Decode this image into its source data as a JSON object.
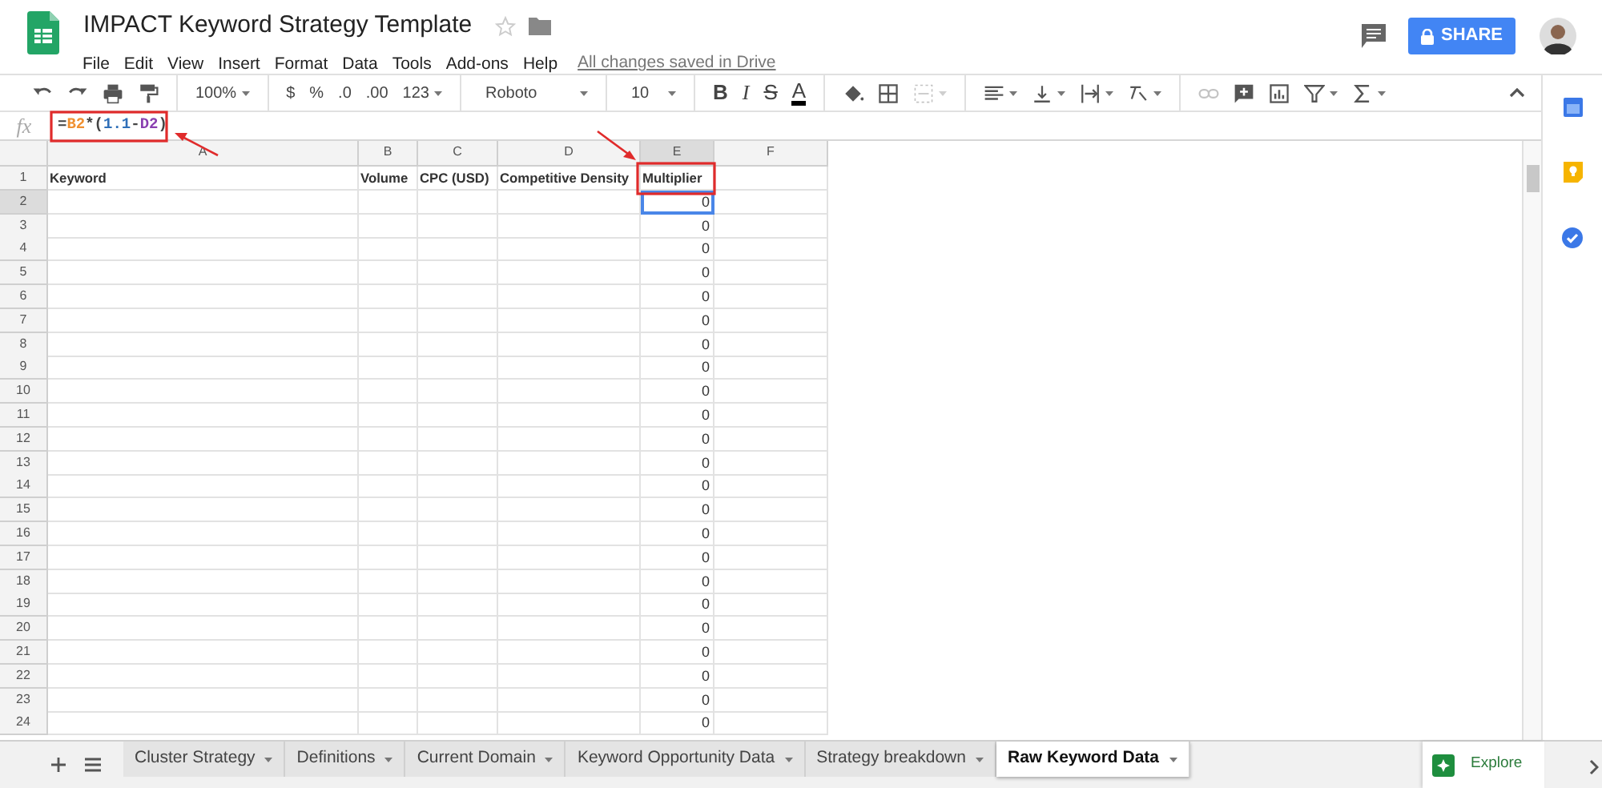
{
  "document": {
    "title": "IMPACT Keyword Strategy Template",
    "save_status": "All changes saved in Drive"
  },
  "menu": [
    "File",
    "Edit",
    "View",
    "Insert",
    "Format",
    "Data",
    "Tools",
    "Add-ons",
    "Help"
  ],
  "share_button": "SHARE",
  "toolbar": [
    {
      "kind": "undo",
      "disabled": false
    },
    {
      "kind": "redo",
      "disabled": false
    },
    {
      "kind": "print",
      "disabled": false
    },
    {
      "kind": "paint",
      "disabled": false
    },
    {
      "kind": "separator"
    },
    {
      "kind": "dropdown",
      "text": "100%",
      "disabled": false
    },
    {
      "kind": "separator"
    },
    {
      "kind": "text",
      "text": "$",
      "disabled": false
    },
    {
      "kind": "text",
      "text": "%",
      "disabled": false
    },
    {
      "kind": "text",
      "text": ".0",
      "disabled": false
    },
    {
      "kind": "text",
      "text": ".00",
      "disabled": false
    },
    {
      "kind": "dropdown",
      "text": "123",
      "disabled": false
    },
    {
      "kind": "separator"
    },
    {
      "kind": "font",
      "text": "Roboto",
      "disabled": false
    },
    {
      "kind": "separator"
    },
    {
      "kind": "font",
      "text": "10",
      "disabled": false
    },
    {
      "kind": "separator"
    },
    {
      "kind": "bold",
      "text": "B",
      "disabled": false
    },
    {
      "kind": "italic",
      "text": "I",
      "disabled": false
    },
    {
      "kind": "strike",
      "text": "S",
      "disabled": false
    },
    {
      "kind": "textcolor",
      "text": "A",
      "disabled": false
    },
    {
      "kind": "separator"
    },
    {
      "kind": "fill",
      "disabled": false
    },
    {
      "kind": "borders",
      "disabled": false
    },
    {
      "kind": "merge",
      "disabled": true
    },
    {
      "kind": "separator"
    },
    {
      "kind": "halign",
      "disabled": false
    },
    {
      "kind": "valign",
      "disabled": false
    },
    {
      "kind": "wrap",
      "disabled": false
    },
    {
      "kind": "rotate",
      "disabled": false
    },
    {
      "kind": "separator"
    },
    {
      "kind": "link",
      "disabled": true
    },
    {
      "kind": "comment",
      "disabled": false
    },
    {
      "kind": "chart",
      "disabled": false
    },
    {
      "kind": "filter",
      "disabled": false
    },
    {
      "kind": "functions",
      "disabled": false
    }
  ],
  "formula_label": "fx",
  "formula": [
    {
      "text": "=",
      "color": "#444444"
    },
    {
      "text": "B2",
      "color": "#f09030"
    },
    {
      "text": "*(",
      "color": "#444444"
    },
    {
      "text": "1.1",
      "color": "#2f6fb8"
    },
    {
      "text": "-",
      "color": "#444444"
    },
    {
      "text": "D2",
      "color": "#8a3fb0"
    },
    {
      "text": ")",
      "color": "#444444"
    }
  ],
  "columns": [
    {
      "label": "A",
      "selected": false
    },
    {
      "label": "B",
      "selected": false
    },
    {
      "label": "C",
      "selected": false
    },
    {
      "label": "D",
      "selected": false
    },
    {
      "label": "E",
      "selected": true
    },
    {
      "label": "F",
      "selected": false
    }
  ],
  "rows": [
    {
      "label": "1",
      "selected": false,
      "cells": [
        {
          "value": "Keyword",
          "kind": "header"
        },
        {
          "value": "Volume",
          "kind": "header"
        },
        {
          "value": "CPC (USD)",
          "kind": "header"
        },
        {
          "value": "Competitive Density",
          "kind": "header"
        },
        {
          "value": "Multiplier",
          "kind": "header"
        },
        {}
      ]
    },
    {
      "label": "2",
      "selected": true,
      "cells": [
        {},
        {},
        {},
        {},
        {
          "value": "0",
          "kind": "number"
        },
        {}
      ]
    },
    {
      "label": "3",
      "selected": false,
      "cells": [
        {},
        {},
        {},
        {},
        {
          "value": "0",
          "kind": "number"
        },
        {}
      ]
    },
    {
      "label": "4",
      "selected": false,
      "cells": [
        {},
        {},
        {},
        {},
        {
          "value": "0",
          "kind": "number"
        },
        {}
      ]
    },
    {
      "label": "5",
      "selected": false,
      "cells": [
        {},
        {},
        {},
        {},
        {
          "value": "0",
          "kind": "number"
        },
        {}
      ]
    },
    {
      "label": "6",
      "selected": false,
      "cells": [
        {},
        {},
        {},
        {},
        {
          "value": "0",
          "kind": "number"
        },
        {}
      ]
    },
    {
      "label": "7",
      "selected": false,
      "cells": [
        {},
        {},
        {},
        {},
        {
          "value": "0",
          "kind": "number"
        },
        {}
      ]
    },
    {
      "label": "8",
      "selected": false,
      "cells": [
        {},
        {},
        {},
        {},
        {
          "value": "0",
          "kind": "number"
        },
        {}
      ]
    },
    {
      "label": "9",
      "selected": false,
      "cells": [
        {},
        {},
        {},
        {},
        {
          "value": "0",
          "kind": "number"
        },
        {}
      ]
    },
    {
      "label": "10",
      "selected": false,
      "cells": [
        {},
        {},
        {},
        {},
        {
          "value": "0",
          "kind": "number"
        },
        {}
      ]
    },
    {
      "label": "11",
      "selected": false,
      "cells": [
        {},
        {},
        {},
        {},
        {
          "value": "0",
          "kind": "number"
        },
        {}
      ]
    },
    {
      "label": "12",
      "selected": false,
      "cells": [
        {},
        {},
        {},
        {},
        {
          "value": "0",
          "kind": "number"
        },
        {}
      ]
    },
    {
      "label": "13",
      "selected": false,
      "cells": [
        {},
        {},
        {},
        {},
        {
          "value": "0",
          "kind": "number"
        },
        {}
      ]
    },
    {
      "label": "14",
      "selected": false,
      "cells": [
        {},
        {},
        {},
        {},
        {
          "value": "0",
          "kind": "number"
        },
        {}
      ]
    },
    {
      "label": "15",
      "selected": false,
      "cells": [
        {},
        {},
        {},
        {},
        {
          "value": "0",
          "kind": "number"
        },
        {}
      ]
    },
    {
      "label": "16",
      "selected": false,
      "cells": [
        {},
        {},
        {},
        {},
        {
          "value": "0",
          "kind": "number"
        },
        {}
      ]
    },
    {
      "label": "17",
      "selected": false,
      "cells": [
        {},
        {},
        {},
        {},
        {
          "value": "0",
          "kind": "number"
        },
        {}
      ]
    },
    {
      "label": "18",
      "selected": false,
      "cells": [
        {},
        {},
        {},
        {},
        {
          "value": "0",
          "kind": "number"
        },
        {}
      ]
    },
    {
      "label": "19",
      "selected": false,
      "cells": [
        {},
        {},
        {},
        {},
        {
          "value": "0",
          "kind": "number"
        },
        {}
      ]
    },
    {
      "label": "20",
      "selected": false,
      "cells": [
        {},
        {},
        {},
        {},
        {
          "value": "0",
          "kind": "number"
        },
        {}
      ]
    },
    {
      "label": "21",
      "selected": false,
      "cells": [
        {},
        {},
        {},
        {},
        {
          "value": "0",
          "kind": "number"
        },
        {}
      ]
    },
    {
      "label": "22",
      "selected": false,
      "cells": [
        {},
        {},
        {},
        {},
        {
          "value": "0",
          "kind": "number"
        },
        {}
      ]
    },
    {
      "label": "23",
      "selected": false,
      "cells": [
        {},
        {},
        {},
        {},
        {
          "value": "0",
          "kind": "number"
        },
        {}
      ]
    },
    {
      "label": "24",
      "selected": false,
      "cells": [
        {},
        {},
        {},
        {},
        {
          "value": "0",
          "kind": "number"
        },
        {}
      ]
    }
  ],
  "sheet_tabs": [
    {
      "label": "Cluster Strategy",
      "selected": false
    },
    {
      "label": "Definitions",
      "selected": false
    },
    {
      "label": "Current Domain",
      "selected": false
    },
    {
      "label": "Keyword Opportunity Data",
      "selected": false
    },
    {
      "label": "Strategy breakdown",
      "selected": false
    },
    {
      "label": "Raw Keyword Data",
      "selected": true
    }
  ],
  "explore_button": "Explore"
}
